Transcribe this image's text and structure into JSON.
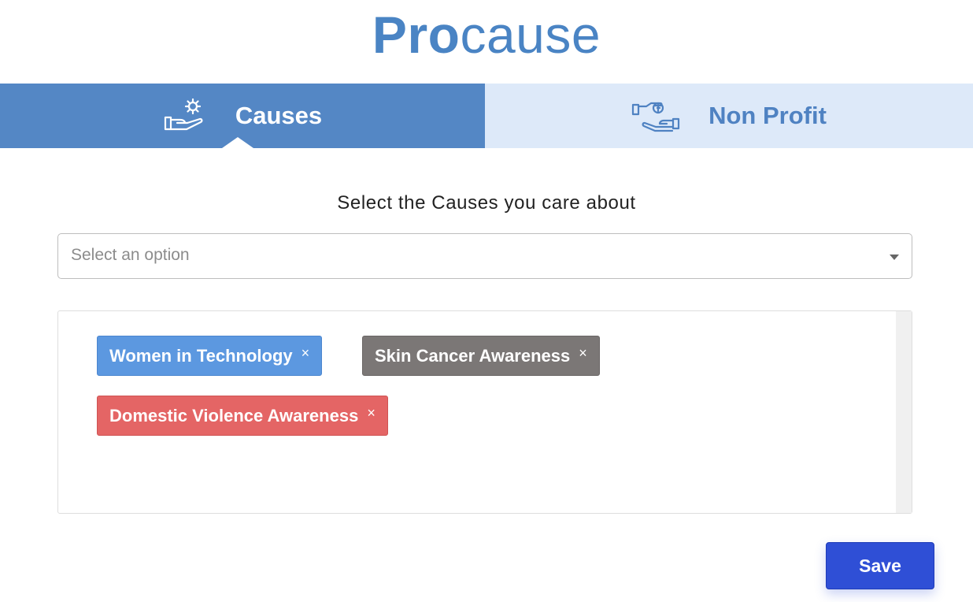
{
  "brand": {
    "logo_bold": "Pro",
    "logo_light": "cause",
    "color": "#4a84c4"
  },
  "tabs": [
    {
      "label": "Causes",
      "icon": "hand-with-gear-icon",
      "active": true,
      "color": "#5487c5"
    },
    {
      "label": "Non Profit",
      "icon": "hand-with-money-icon",
      "active": false,
      "color": "#dde9f9"
    }
  ],
  "main": {
    "prompt": "Select the Causes you care about",
    "select": {
      "placeholder": "Select an option",
      "icon": "dropdown-caret-icon"
    },
    "chips": [
      {
        "label": "Women in Technology",
        "remove": "×",
        "color": "#5c98e0"
      },
      {
        "label": "Skin Cancer Awareness",
        "remove": "×",
        "color": "#7b7776"
      },
      {
        "label": "Domestic Violence Awareness",
        "remove": "×",
        "color": "#e46565"
      }
    ]
  },
  "footer": {
    "save_label": "Save",
    "save_color": "#2f4fd6"
  }
}
